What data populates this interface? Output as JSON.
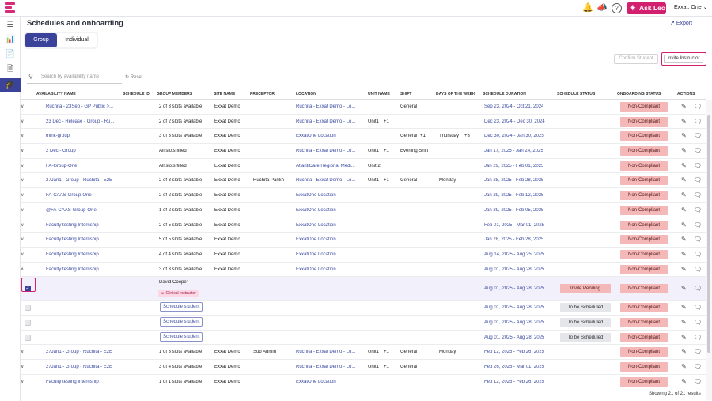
{
  "header": {
    "ask_leo": "Ask Leo",
    "user_name": "Exxat, One"
  },
  "page": {
    "title": "Schedules and onboarding",
    "export_label": "Export",
    "tabs": [
      "Group",
      "Individual"
    ],
    "confirm_student": "Confirm Student",
    "invite_instructor": "Invite Instructor",
    "search_placeholder": "Search by availability name",
    "reset_label": "Reset",
    "results": "Showing 21 of 21 results"
  },
  "columns": [
    "AVAILABILITY NAME",
    "SCHEDULE ID",
    "GROUP MEMBERS",
    "SITE NAME",
    "PRECEPTOR",
    "LOCATION",
    "UNIT NAME",
    "SHIFT",
    "DAYS OF THE WEEK",
    "SCHEDULE DURATION",
    "SCHEDULE STATUS",
    "ONBOARDING STATUS",
    "ACTIONS"
  ],
  "rows": [
    {
      "name": "Ruchita - 23Sep - GP Public >...",
      "members": "2 of 3 slots available",
      "site": "Exxat Demo",
      "preceptor": "",
      "location": "Ruchita - Exxat Demo - Lo...",
      "unit": "",
      "unit_more": "",
      "shift": "General",
      "shift_more": "",
      "days": "",
      "days_more": "",
      "duration": "Sep 23, 2024 - Oct 21, 2024",
      "onboarding": "Non-Compliant"
    },
    {
      "name": "23 Dec - Release - Group - Ru...",
      "members": "2 of 2 slots available",
      "site": "Exxat Demo",
      "preceptor": "",
      "location": "Ruchita - Exxat Demo - Lo...",
      "unit": "Unit1",
      "unit_more": "+1",
      "shift": "",
      "shift_more": "",
      "days": "",
      "days_more": "",
      "duration": "Dec 23, 2024 - Dec 30, 2024",
      "onboarding": "Non-Compliant"
    },
    {
      "name": "think-group",
      "members": "3 of 3 slots available",
      "site": "Exxat Demo",
      "preceptor": "",
      "location": "ExxatOne Location",
      "unit": "",
      "unit_more": "",
      "shift": "General",
      "shift_more": "+1",
      "days": "Thursday",
      "days_more": "+3",
      "duration": "Dec 30, 2024 - Jan 30, 2025",
      "onboarding": "Non-Compliant"
    },
    {
      "name": "2 Dec - Group",
      "members": "All slots filled",
      "site": "Exxat Demo",
      "preceptor": "",
      "location": "Ruchita - Exxat Demo - Lo...",
      "unit": "Unit1",
      "unit_more": "+1",
      "shift": "Evening Shift",
      "shift_more": "",
      "days": "",
      "days_more": "",
      "duration": "Jan 17, 2025 - Jan 24, 2025",
      "onboarding": "Non-Compliant"
    },
    {
      "name": "FA-Group-One",
      "members": "All slots filled",
      "site": "Exxat Demo",
      "preceptor": "",
      "location": "AtlantiCare Regional Medi...",
      "unit": "Unit 2",
      "unit_more": "",
      "shift": "",
      "shift_more": "",
      "days": "",
      "days_more": "",
      "duration": "Jan 29, 2025 - Feb 01, 2025",
      "onboarding": "Non-Compliant"
    },
    {
      "name": "27Jan1 - Group - Ruchita - E2E",
      "members": "2 of 3 slots available",
      "site": "Exxat Demo",
      "preceptor": "Ruchita Parikh",
      "location": "Ruchita - Exxat Demo - Lo...",
      "unit": "Unit1",
      "unit_more": "+1",
      "shift": "General",
      "shift_more": "",
      "days": "Monday",
      "days_more": "",
      "duration": "Jan 28, 2025 - Feb 28, 2025",
      "onboarding": "Non-Compliant"
    },
    {
      "name": "FA-CAAS-Group-One",
      "members": "2 of 2 slots available",
      "site": "Exxat Demo",
      "preceptor": "",
      "location": "ExxatOne Location",
      "unit": "",
      "unit_more": "",
      "shift": "",
      "shift_more": "",
      "days": "",
      "days_more": "",
      "duration": "Jan 29, 2025 - Feb 12, 2025",
      "onboarding": "Non-Compliant"
    },
    {
      "name": "@FA-CAAS-Group-One",
      "members": "1 of 2 slots available",
      "site": "Exxat Demo",
      "preceptor": "",
      "location": "ExxatOne Location",
      "unit": "",
      "unit_more": "",
      "shift": "",
      "shift_more": "",
      "days": "",
      "days_more": "",
      "duration": "Jan 29, 2025 - Feb 05, 2025",
      "onboarding": "Non-Compliant"
    },
    {
      "name": "Faculty testing Internship",
      "members": "2 of 5 slots available",
      "site": "Exxat Demo",
      "preceptor": "",
      "location": "ExxatOne Location",
      "unit": "",
      "unit_more": "",
      "shift": "",
      "shift_more": "",
      "days": "",
      "days_more": "",
      "duration": "Feb 01, 2025 - Mar 01, 2025",
      "onboarding": "Non-Compliant"
    },
    {
      "name": "Faculty testing Internship",
      "members": "5 of 5 slots available",
      "site": "Exxat Demo",
      "preceptor": "",
      "location": "ExxatOne Location",
      "unit": "",
      "unit_more": "",
      "shift": "",
      "shift_more": "",
      "days": "",
      "days_more": "",
      "duration": "Jan 28, 2025 - Feb 28, 2025",
      "onboarding": "Non-Compliant"
    },
    {
      "name": "Faculty testing Internship",
      "members": "4 of 4 slots available",
      "site": "Exxat Demo",
      "preceptor": "",
      "location": "ExxatOne Location",
      "unit": "",
      "unit_more": "",
      "shift": "",
      "shift_more": "",
      "days": "",
      "days_more": "",
      "duration": "Aug 14, 2025 - Aug 25, 2025",
      "onboarding": "Non-Compliant"
    },
    {
      "name": "Faculty testing Internship",
      "members": "3 of 3 slots available",
      "site": "Exxat Demo",
      "preceptor": "",
      "location": "ExxatOne Location",
      "unit": "",
      "unit_more": "",
      "shift": "",
      "shift_more": "",
      "days": "",
      "days_more": "",
      "duration": "Aug 01, 2025 - Aug 28, 2025",
      "onboarding": "Non-Compliant",
      "expanded": true
    }
  ],
  "children": [
    {
      "member": "David Cooper",
      "role": "Clinical Instructor",
      "duration": "Aug 01, 2025 - Aug 28, 2025",
      "status": "Invite Pending",
      "onboarding": "Non-Compliant",
      "checked": true
    },
    {
      "schedule": "Schedule student",
      "duration": "Aug 01, 2025 - Aug 28, 2025",
      "status": "To be Scheduled",
      "onboarding": "Non-Compliant"
    },
    {
      "schedule": "Schedule student",
      "duration": "Aug 01, 2025 - Aug 28, 2025",
      "status": "To be Scheduled",
      "onboarding": "Non-Compliant"
    },
    {
      "schedule": "Schedule student",
      "duration": "Aug 01, 2025 - Aug 28, 2025",
      "status": "To be Scheduled",
      "onboarding": "Non-Compliant"
    }
  ],
  "rows_after": [
    {
      "name": "27Jan1 - Group - Ruchita - E2E",
      "members": "1 of 3 slots available",
      "site": "Exxat Demo",
      "preceptor": "Sub Admin",
      "location": "Ruchita - Exxat Demo - Lo...",
      "unit": "Unit1",
      "unit_more": "+1",
      "shift": "General",
      "shift_more": "",
      "days": "Monday",
      "days_more": "",
      "duration": "Feb 12, 2025 - Feb 26, 2025",
      "onboarding": "Non-Compliant"
    },
    {
      "name": "27Jan1 - Group - Ruchita - E2E",
      "members": "3 of 4 slots available",
      "site": "Exxat Demo",
      "preceptor": "",
      "location": "Ruchita - Exxat Demo - Lo...",
      "unit": "Unit1",
      "unit_more": "+1",
      "shift": "General",
      "shift_more": "",
      "days": "",
      "days_more": "",
      "duration": "Feb 26, 2025 - Mar 01, 2025",
      "onboarding": "Non-Compliant"
    },
    {
      "name": "Faculty testing Internship",
      "members": "1 of 1 slots available",
      "site": "Exxat Demo",
      "preceptor": "",
      "location": "ExxatOne Location",
      "unit": "",
      "unit_more": "",
      "shift": "",
      "shift_more": "",
      "days": "",
      "days_more": "",
      "duration": "Feb 12, 2025 - Feb 26, 2025",
      "onboarding": "Non-Compliant"
    }
  ]
}
